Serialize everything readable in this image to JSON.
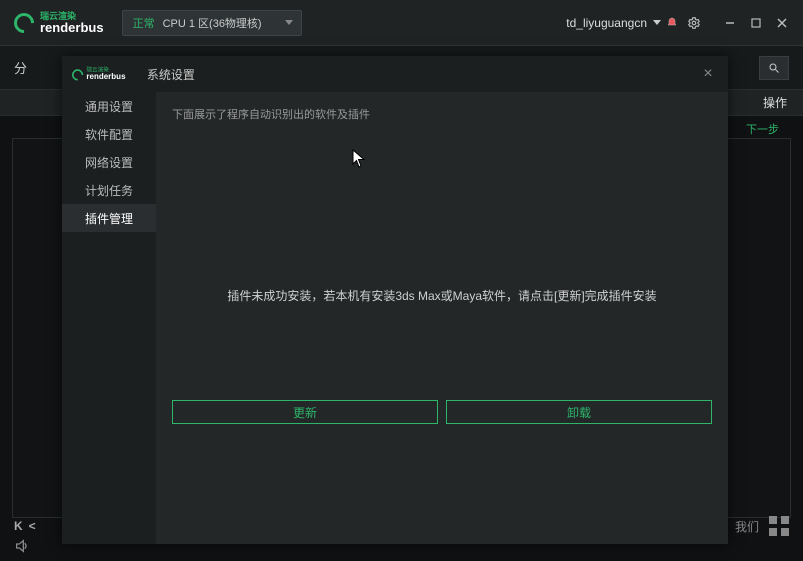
{
  "app": {
    "brand_cn": "瑞云渲染",
    "brand_en": "renderbus"
  },
  "region": {
    "status": "正常",
    "name": "CPU 1 区(36物理核)"
  },
  "user": {
    "name": "td_liyuguangcn"
  },
  "toolbar": {
    "left_label": "分",
    "operate_col": "操作",
    "next_step": "下一步"
  },
  "modal": {
    "title": "系统设置",
    "sidebar": {
      "items": [
        {
          "label": "通用设置"
        },
        {
          "label": "软件配置"
        },
        {
          "label": "网络设置"
        },
        {
          "label": "计划任务"
        },
        {
          "label": "插件管理"
        }
      ]
    },
    "hint": "下面展示了程序自动识别出的软件及插件",
    "message": "插件未成功安装，若本机有安装3ds Max或Maya软件，请点击[更新]完成插件安装",
    "update_btn": "更新",
    "uninstall_btn": "卸载"
  },
  "status": {
    "contact_suffix": "我们"
  }
}
